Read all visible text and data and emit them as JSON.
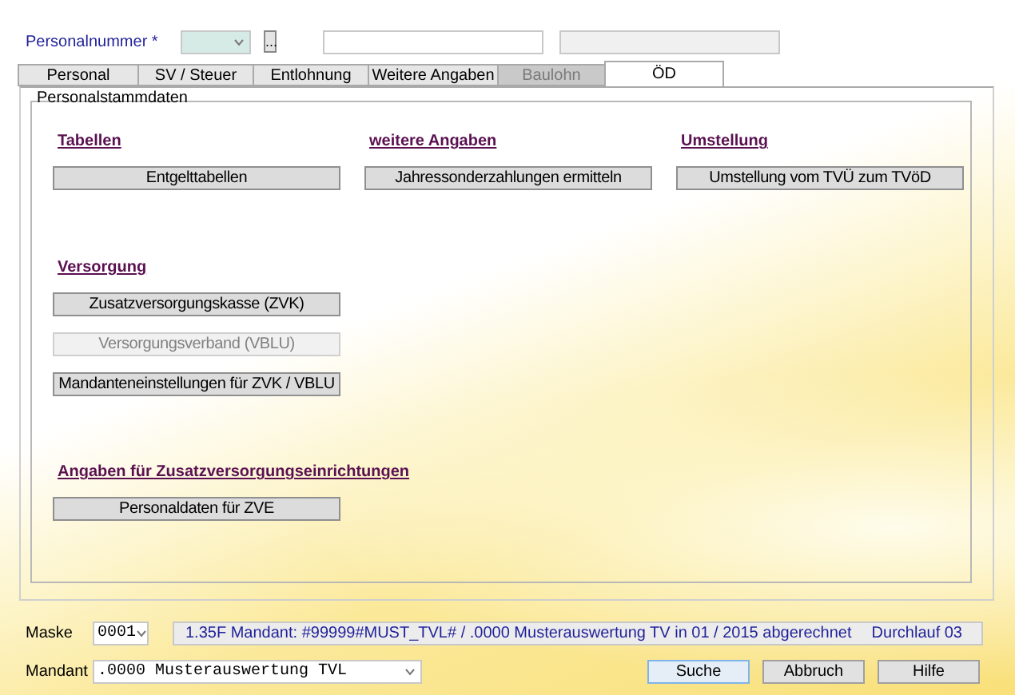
{
  "header": {
    "label": "Personalnummer *",
    "lookup_button": "..."
  },
  "tabs": [
    {
      "label": "Personal",
      "selected": false,
      "disabled": false
    },
    {
      "label": "SV / Steuer",
      "selected": false,
      "disabled": false
    },
    {
      "label": "Entlohnung",
      "selected": false,
      "disabled": false
    },
    {
      "label": "Weitere Angaben",
      "selected": false,
      "disabled": false
    },
    {
      "label": "Baulohn",
      "selected": false,
      "disabled": true
    },
    {
      "label": "ÖD",
      "selected": true,
      "disabled": false
    }
  ],
  "group": {
    "title": "Personalstammdaten",
    "rows": [
      [
        {
          "heading": "Tabellen",
          "buttons": [
            {
              "label": "Entgelttabellen",
              "disabled": false
            }
          ]
        },
        {
          "heading": "weitere Angaben",
          "buttons": [
            {
              "label": "Jahressonderzahlungen ermitteln",
              "disabled": false
            }
          ]
        },
        {
          "heading": "Umstellung",
          "buttons": [
            {
              "label": "Umstellung vom TVÜ zum TVöD",
              "disabled": false
            }
          ]
        }
      ],
      [
        {
          "heading": "Versorgung",
          "buttons": [
            {
              "label": "Zusatzversorgungskasse (ZVK)",
              "disabled": false
            },
            {
              "label": "Versorgungsverband (VBLU)",
              "disabled": true
            },
            {
              "label": "Mandanteneinstellungen für ZVK / VBLU",
              "disabled": false
            }
          ]
        }
      ],
      [
        {
          "heading": "Angaben für Zusatzversorgungseinrichtungen",
          "buttons": [
            {
              "label": "Personaldaten für ZVE",
              "disabled": false
            }
          ]
        }
      ]
    ]
  },
  "footer": {
    "mask_label": "Maske",
    "mask_value": "0001",
    "status_text": "1.35F Mandant: #99999#MUST_TVL# / .0000 Musterauswertung TV in 01 / 2015 abgerechnet",
    "status_run": "Durchlauf 03",
    "client_label": "Mandant",
    "client_value": ".0000 Musterauswertung TVL",
    "buttons": [
      {
        "label": "Suche",
        "selected": true
      },
      {
        "label": "Abbruch",
        "selected": false
      },
      {
        "label": "Hilfe",
        "selected": false
      }
    ]
  }
}
